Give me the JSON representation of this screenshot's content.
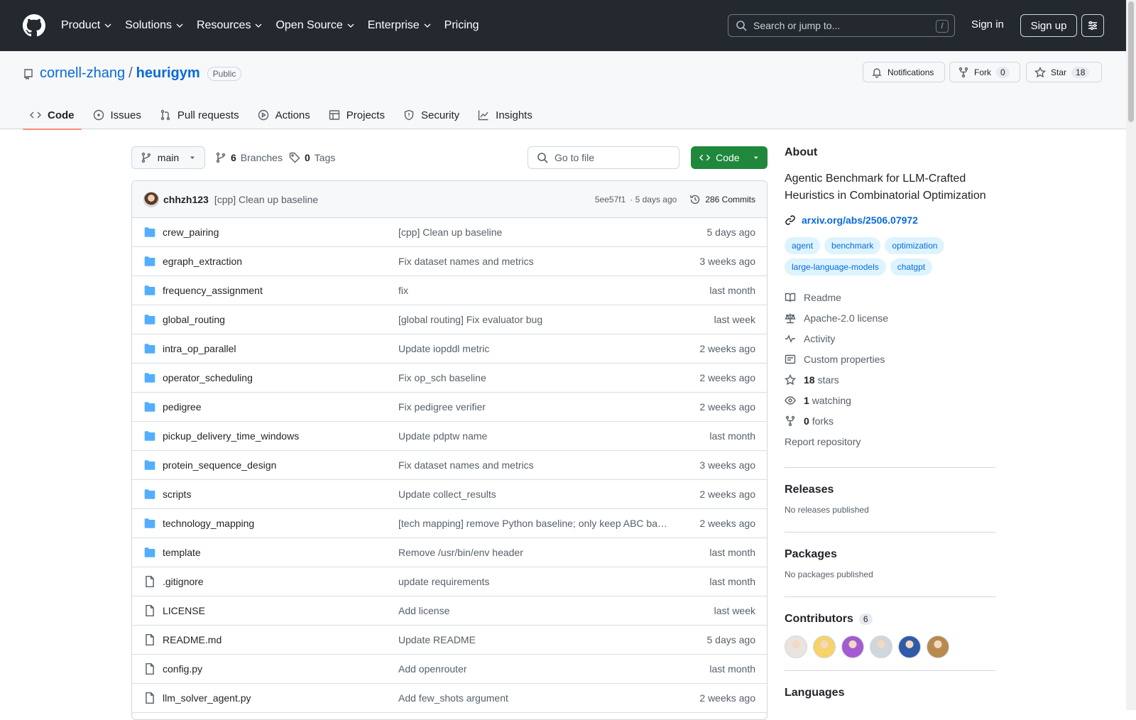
{
  "nav": {
    "items": [
      "Product",
      "Solutions",
      "Resources",
      "Open Source",
      "Enterprise",
      "Pricing"
    ],
    "search_placeholder": "Search or jump to...",
    "search_key": "/",
    "signin": "Sign in",
    "signup": "Sign up"
  },
  "repo": {
    "owner": "cornell-zhang",
    "name": "heurigym",
    "visibility": "Public",
    "notifications": "Notifications",
    "fork_label": "Fork",
    "fork_count": "0",
    "star_label": "Star",
    "star_count": "18"
  },
  "tabs": [
    "Code",
    "Issues",
    "Pull requests",
    "Actions",
    "Projects",
    "Security",
    "Insights"
  ],
  "toolbar": {
    "branch": "main",
    "branches_count": "6",
    "branches_label": "Branches",
    "tags_count": "0",
    "tags_label": "Tags",
    "goto_file": "Go to file",
    "code_button": "Code"
  },
  "commit": {
    "author": "chhzh123",
    "message": "[cpp] Clean up baseline",
    "sha": "5ee57f1",
    "time": "· 5 days ago",
    "commits": "286 Commits"
  },
  "files": [
    {
      "name": "crew_pairing",
      "msg": "[cpp] Clean up baseline",
      "date": "5 days ago",
      "type": "dir"
    },
    {
      "name": "egraph_extraction",
      "msg": "Fix dataset names and metrics",
      "date": "3 weeks ago",
      "type": "dir"
    },
    {
      "name": "frequency_assignment",
      "msg": "fix",
      "date": "last month",
      "type": "dir"
    },
    {
      "name": "global_routing",
      "msg": "[global routing] Fix evaluator bug",
      "date": "last week",
      "type": "dir"
    },
    {
      "name": "intra_op_parallel",
      "msg": "Update iopddl metric",
      "date": "2 weeks ago",
      "type": "dir"
    },
    {
      "name": "operator_scheduling",
      "msg": "Fix op_sch baseline",
      "date": "2 weeks ago",
      "type": "dir"
    },
    {
      "name": "pedigree",
      "msg": "Fix pedigree verifier",
      "date": "2 weeks ago",
      "type": "dir"
    },
    {
      "name": "pickup_delivery_time_windows",
      "msg": "Update pdptw name",
      "date": "last month",
      "type": "dir"
    },
    {
      "name": "protein_sequence_design",
      "msg": "Fix dataset names and metrics",
      "date": "3 weeks ago",
      "type": "dir"
    },
    {
      "name": "scripts",
      "msg": "Update collect_results",
      "date": "2 weeks ago",
      "type": "dir"
    },
    {
      "name": "technology_mapping",
      "msg": "[tech mapping] remove Python baseline; only keep ABC ba…",
      "date": "2 weeks ago",
      "type": "dir"
    },
    {
      "name": "template",
      "msg": "Remove /usr/bin/env header",
      "date": "last month",
      "type": "dir"
    },
    {
      "name": ".gitignore",
      "msg": "update requirements",
      "date": "last month",
      "type": "file"
    },
    {
      "name": "LICENSE",
      "msg": "Add license",
      "date": "last week",
      "type": "file"
    },
    {
      "name": "README.md",
      "msg": "Update README",
      "date": "5 days ago",
      "type": "file"
    },
    {
      "name": "config.py",
      "msg": "Add openrouter",
      "date": "last month",
      "type": "file"
    },
    {
      "name": "llm_solver_agent.py",
      "msg": "Add few_shots argument",
      "date": "2 weeks ago",
      "type": "file"
    }
  ],
  "about": {
    "title": "About",
    "description": "Agentic Benchmark for LLM-Crafted Heuristics in Combinatorial Optimization",
    "link": "arxiv.org/abs/2506.07972",
    "topics": [
      "agent",
      "benchmark",
      "optimization",
      "large-language-models",
      "chatgpt"
    ],
    "readme": "Readme",
    "license": "Apache-2.0 license",
    "activity": "Activity",
    "custom": "Custom properties",
    "stars_n": "18",
    "stars_label": "stars",
    "watching_n": "1",
    "watching_label": "watching",
    "forks_n": "0",
    "forks_label": "forks",
    "report": "Report repository"
  },
  "releases": {
    "title": "Releases",
    "empty": "No releases published"
  },
  "packages": {
    "title": "Packages",
    "empty": "No packages published"
  },
  "contributors": {
    "title": "Contributors",
    "count": "6",
    "colors": [
      "#e9e4df",
      "#f6d36b",
      "#a35bd1",
      "#cfd6dc",
      "#2f5aa8",
      "#b98a4f"
    ]
  },
  "languages": {
    "title": "Languages"
  },
  "colors": {
    "header_bg": "#24292f",
    "link": "#0969da",
    "code_button": "#1f883d",
    "active_tab": "#fd8c73"
  }
}
